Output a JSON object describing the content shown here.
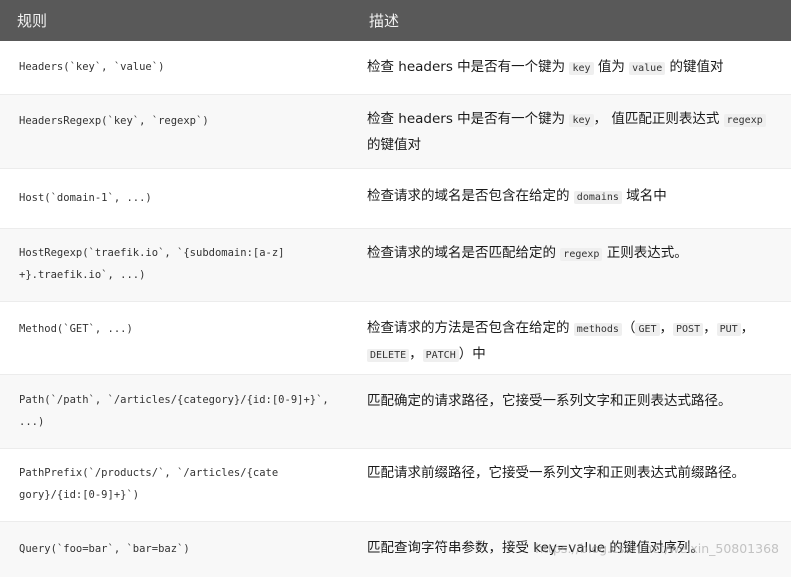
{
  "header": {
    "col_rule": "规则",
    "col_desc": "描述"
  },
  "rows": [
    {
      "rule": "Headers(`key`, `value`)",
      "desc": [
        {
          "t": "检查 headers 中是否有一个键为 "
        },
        {
          "c": "key"
        },
        {
          "t": " 值为 "
        },
        {
          "c": "value"
        },
        {
          "t": " 的键值对"
        }
      ]
    },
    {
      "rule": "HeadersRegexp(`key`, `regexp`)",
      "desc": [
        {
          "t": "检查 headers 中是否有一个键为 "
        },
        {
          "c": "key"
        },
        {
          "t": "， 值匹配正则表达式 "
        },
        {
          "c": "regexp"
        },
        {
          "t": " 的键值对"
        }
      ]
    },
    {
      "rule": "Host(`domain-1`, ...)",
      "desc": [
        {
          "t": "检查请求的域名是否包含在给定的 "
        },
        {
          "c": "domains"
        },
        {
          "t": " 域名中"
        }
      ]
    },
    {
      "rule": "HostRegexp(`traefik.io`, `{subdomain:[a-z]+}.traefik.io`, ...)",
      "desc": [
        {
          "t": "检查请求的域名是否匹配给定的 "
        },
        {
          "c": "regexp"
        },
        {
          "t": " 正则表达式。"
        }
      ]
    },
    {
      "rule": "Method(`GET`, ...)",
      "desc": [
        {
          "t": "检查请求的方法是否包含在给定的 "
        },
        {
          "c": "methods"
        },
        {
          "t": "（"
        },
        {
          "c": "GET"
        },
        {
          "t": "，"
        },
        {
          "c": "POST"
        },
        {
          "t": "，"
        },
        {
          "c": "PUT"
        },
        {
          "t": "，"
        },
        {
          "c": "DELETE"
        },
        {
          "t": "，"
        },
        {
          "c": "PATCH"
        },
        {
          "t": "）中"
        }
      ]
    },
    {
      "rule": "Path(`/path`, `/articles/{category}/{id:[0-9]+}`, ...)",
      "desc": [
        {
          "t": "匹配确定的请求路径，它接受一系列文字和正则表达式路径。"
        }
      ]
    },
    {
      "rule": "PathPrefix(`/products/`, `/articles/{category}/{id:[0-9]+}`)",
      "desc": [
        {
          "t": "匹配请求前缀路径，它接受一系列文字和正则表达式前缀路径。"
        }
      ]
    },
    {
      "rule": "Query(`foo=bar`, `bar=baz`)",
      "desc": [
        {
          "t": "匹配查询字符串参数，接受 key=value 的键值对序列。"
        }
      ]
    }
  ],
  "watermark": "https://blog.csdn.net/weixin_50801368"
}
